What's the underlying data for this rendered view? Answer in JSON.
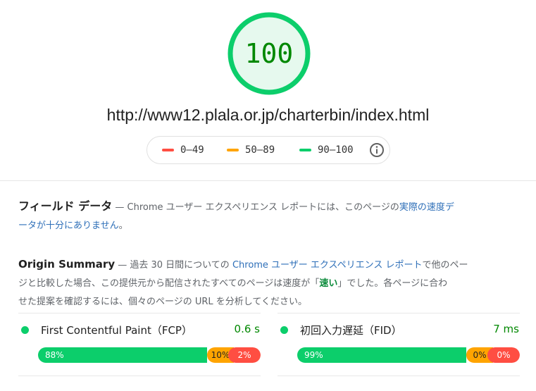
{
  "score": "100",
  "url": "http://www12.plala.or.jp/charterbin/index.html",
  "legend": [
    {
      "label": "0–49",
      "color": "#ff4e42"
    },
    {
      "label": "50–89",
      "color": "#ffa400"
    },
    {
      "label": "90–100",
      "color": "#0cce6b"
    }
  ],
  "field": {
    "title": "フィールド データ",
    "desc_1": " — Chrome ユーザー エクスペリエンス レポートには、このページの",
    "link_1": "実際の速度デ",
    "link_2": "ータが十分にありません",
    "desc_end": "。"
  },
  "origin": {
    "title": "Origin Summary",
    "desc_1": " — 過去 30 日間についての ",
    "link": "Chrome ユーザー エクスペリエンス レポート",
    "desc_2": "で他のペー",
    "desc_3": "ジと比較した場合、この提供元から配信されたすべてのページは速度が「",
    "speed": "速い",
    "desc_4": "」でした。各ページに合わ",
    "desc_5": "せた提案を確認するには、個々のページの URL を分析してください。"
  },
  "metrics": [
    {
      "name": "First Contentful Paint（FCP）",
      "value": "0.6 s",
      "good": 88,
      "avg": 10,
      "poor": 2,
      "good_label": "88%",
      "avg_label": "10%",
      "poor_label": "2%"
    },
    {
      "name": "初回入力遅延（FID）",
      "value": "7 ms",
      "good": 99,
      "avg": 0,
      "poor": 0,
      "good_label": "99%",
      "avg_label": "0%",
      "poor_label": "0%"
    }
  ],
  "colors": {
    "good": "#0cce6b",
    "average": "#ffa400",
    "poor": "#ff4e42"
  },
  "icons": {
    "legend_info": "info-icon"
  }
}
